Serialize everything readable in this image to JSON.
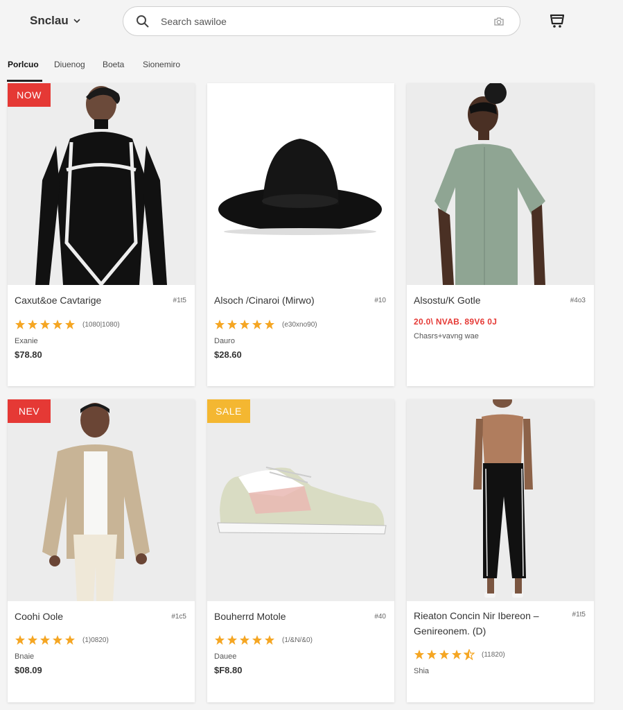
{
  "header": {
    "brand": "Snclau",
    "search_placeholder": "Search sawiloe"
  },
  "tabs": [
    "Porlcuo",
    "Diuenog",
    "Boeta",
    "Sionemiro"
  ],
  "products": [
    {
      "badge": "NOW",
      "name": "Caxut&oe Cavtarige",
      "code": "#1t5",
      "rating": 5,
      "rating_count": "(1080|1080)",
      "meta": "Exanie",
      "price": "$78.80"
    },
    {
      "badge": "",
      "name": "Alsoch /Cinaroi (Mirwo)",
      "code": "#10",
      "rating": 5,
      "rating_count": "(e30xno90)",
      "meta": "Dauro",
      "price": "$28.60"
    },
    {
      "badge": "",
      "name": "Alsostu/K Gotle",
      "code": "#4o3",
      "promo": "20.0\\ NVAB. 89V6 0J",
      "meta": "Chasrs+vavng wae",
      "price": ""
    },
    {
      "badge": "NEV",
      "name": "Coohi Oole",
      "code": "#1c5",
      "rating": 5,
      "rating_count": "(1)0820)",
      "meta": "Bnaie",
      "price": "$08.09"
    },
    {
      "badge": "SALE",
      "name": "Bouherrd Motole",
      "code": "#40",
      "rating": 5,
      "rating_count": "(1/&N/&0)",
      "meta": "Dauee",
      "price": "$F8.80"
    },
    {
      "badge": "",
      "name": "Rieaton Concin Nir Ibereon –\nGenireonem. (D)",
      "code": "#1t5",
      "rating": 4.5,
      "rating_count": "(11820)",
      "meta": "Shia",
      "price": ""
    }
  ],
  "colors": {
    "accent_new": "#e53935",
    "accent_sale": "#f4b731",
    "star": "#f5a623"
  }
}
